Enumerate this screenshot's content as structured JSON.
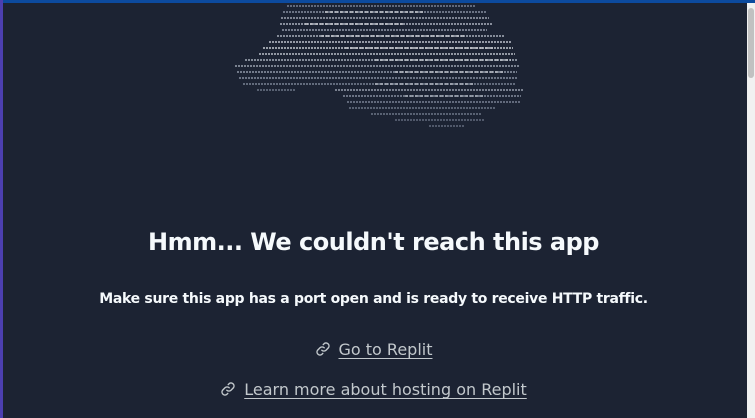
{
  "error": {
    "title": "Hmm... We couldn't reach this app",
    "message": "Make sure this app has a port open and is ready to receive HTTP traffic."
  },
  "links": [
    {
      "label": "Go to Replit",
      "icon": "link-icon"
    },
    {
      "label": "Learn more about hosting on Replit",
      "icon": "link-icon"
    }
  ],
  "colors": {
    "background": "#1c2333",
    "text_primary": "#f5f9fc",
    "text_link": "#c2c8cc",
    "top_accent": "#0c4a9e",
    "left_accent": "#4c3fb0"
  }
}
